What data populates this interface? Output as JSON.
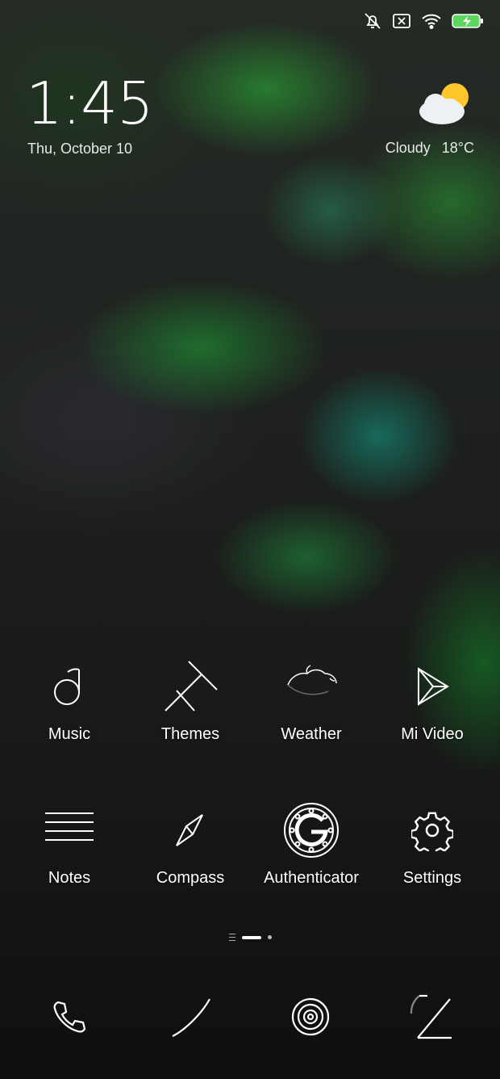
{
  "status_bar": {
    "icons": [
      "notifications-off-icon",
      "sim-missing-icon",
      "wifi-icon",
      "battery-charging-icon"
    ],
    "battery_color": "#5cd65c"
  },
  "lockclock": {
    "time": "1:45",
    "date": "Thu, October 10"
  },
  "weather_widget": {
    "icon": "partly-cloudy-icon",
    "condition": "Cloudy",
    "temperature": "18°C"
  },
  "apps": [
    {
      "label": "Music",
      "icon": "music-icon"
    },
    {
      "label": "Themes",
      "icon": "themes-icon"
    },
    {
      "label": "Weather",
      "icon": "weather-icon"
    },
    {
      "label": "Mi Video",
      "icon": "mi-video-icon"
    },
    {
      "label": "Notes",
      "icon": "notes-icon"
    },
    {
      "label": "Compass",
      "icon": "compass-icon"
    },
    {
      "label": "Authenticator",
      "icon": "authenticator-icon"
    },
    {
      "label": "Settings",
      "icon": "settings-icon"
    }
  ],
  "page_indicator": {
    "pages": 3,
    "current": 2
  },
  "dock": [
    {
      "icon": "phone-icon"
    },
    {
      "icon": "browser-icon"
    },
    {
      "icon": "camera-icon"
    },
    {
      "icon": "gallery-icon"
    }
  ]
}
